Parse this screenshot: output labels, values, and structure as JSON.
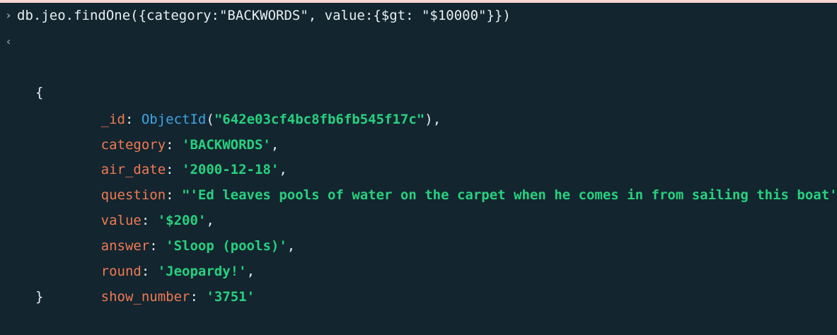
{
  "command": {
    "prompt_icon": "chevron-right-icon",
    "text": "db.jeo.findOne({category:\"BACKWORDS\", value:{$gt: \"$10000\"}})"
  },
  "output": {
    "result_icon": "chevron-left-icon",
    "open_brace": "{",
    "close_brace": "}",
    "colon": ": ",
    "comma": ",",
    "id_key": "_id",
    "id_func": "ObjectId",
    "id_open": "(",
    "id_value": "\"642e03cf4bc8fb6fb545f17c\"",
    "id_close": ")",
    "fields": [
      {
        "key": "category",
        "value": "'BACKWORDS'"
      },
      {
        "key": "air_date",
        "value": "'2000-12-18'"
      },
      {
        "key": "question",
        "value": "\"'Ed leaves pools of water on the carpet when he comes in from sailing this boat'\""
      },
      {
        "key": "value",
        "value": "'$200'"
      },
      {
        "key": "answer",
        "value": "'Sloop (pools)'"
      },
      {
        "key": "round",
        "value": "'Jeopardy!'"
      },
      {
        "key": "show_number",
        "value": "'3751'"
      }
    ]
  },
  "colors": {
    "background": "#13252f",
    "key": "#ef7a53",
    "string": "#27d17f",
    "function": "#3ca6e6",
    "text": "#e6edf0"
  }
}
